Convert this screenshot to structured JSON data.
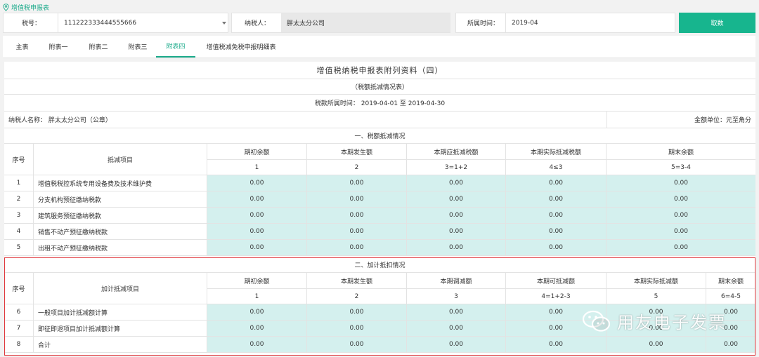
{
  "breadcrumb": "增值税申报表",
  "header": {
    "tax_id_label": "税号：",
    "tax_id_value": "111222333444555666",
    "payer_label": "纳税人：",
    "payer_value": "胖太太分公司",
    "period_label": "所属时间：",
    "period_value": "2019-04",
    "fetch_label": "取数"
  },
  "tabs": [
    "主表",
    "附表一",
    "附表二",
    "附表三",
    "附表四",
    "增值税减免税申报明细表"
  ],
  "active_tab": "附表四",
  "form": {
    "title": "增值税纳税申报表附列资料（四）",
    "subtitle": "（税额抵减情况表）",
    "period_text": "税款所属时间： 2019-04-01 至 2019-04-30",
    "payer_name": "纳税人名称： 胖太太分公司（公章）",
    "unit": "金额单位：元至角分"
  },
  "section1": {
    "heading": "一、税额抵减情况",
    "col_seq": "序号",
    "col_item": "抵减项目",
    "headers": [
      "期初余额",
      "本期发生额",
      "本期应抵减税额",
      "本期实际抵减税额",
      "期末余额"
    ],
    "codes": [
      "1",
      "2",
      "3=1+2",
      "4≤3",
      "5=3-4"
    ],
    "rows": [
      {
        "seq": "1",
        "item": "增值税税控系统专用设备费及技术维护费",
        "values": [
          "0.00",
          "0.00",
          "0.00",
          "0.00",
          "0.00"
        ]
      },
      {
        "seq": "2",
        "item": "分支机构预征缴纳税款",
        "values": [
          "0.00",
          "0.00",
          "0.00",
          "0.00",
          "0.00"
        ]
      },
      {
        "seq": "3",
        "item": "建筑服务预征缴纳税款",
        "values": [
          "0.00",
          "0.00",
          "0.00",
          "0.00",
          "0.00"
        ]
      },
      {
        "seq": "4",
        "item": "销售不动产预征缴纳税款",
        "values": [
          "0.00",
          "0.00",
          "0.00",
          "0.00",
          "0.00"
        ]
      },
      {
        "seq": "5",
        "item": "出租不动产预征缴纳税款",
        "values": [
          "0.00",
          "0.00",
          "0.00",
          "0.00",
          "0.00"
        ]
      }
    ]
  },
  "section2": {
    "heading": "二、加计抵扣情况",
    "col_seq": "序号",
    "col_item": "加计抵减项目",
    "headers": [
      "期初余额",
      "本期发生额",
      "本期调减额",
      "本期可抵减额",
      "本期实际抵减额",
      "期末余额"
    ],
    "codes": [
      "1",
      "2",
      "3",
      "4=1+2-3",
      "5",
      "6=4-5"
    ],
    "rows": [
      {
        "seq": "6",
        "item": "一般项目加计抵减额计算",
        "values": [
          "0.00",
          "0.00",
          "0.00",
          "0.00",
          "0.00",
          "0.00"
        ]
      },
      {
        "seq": "7",
        "item": "即征即退项目加计抵减额计算",
        "values": [
          "0.00",
          "0.00",
          "0.00",
          "0.00",
          "0.00",
          "0.00"
        ]
      },
      {
        "seq": "8",
        "item": "合计",
        "values": [
          "0.00",
          "0.00",
          "0.00",
          "0.00",
          "0.00",
          "0.00"
        ]
      }
    ]
  },
  "watermark": "用友电子发票",
  "colors": {
    "accent": "#1aaa8a",
    "button": "#17b58e",
    "input_cell": "#d4f0ee",
    "highlight_border": "#e0393e"
  },
  "icons": [
    "location-pin-icon",
    "chevron-down-icon",
    "wechat-icon"
  ]
}
